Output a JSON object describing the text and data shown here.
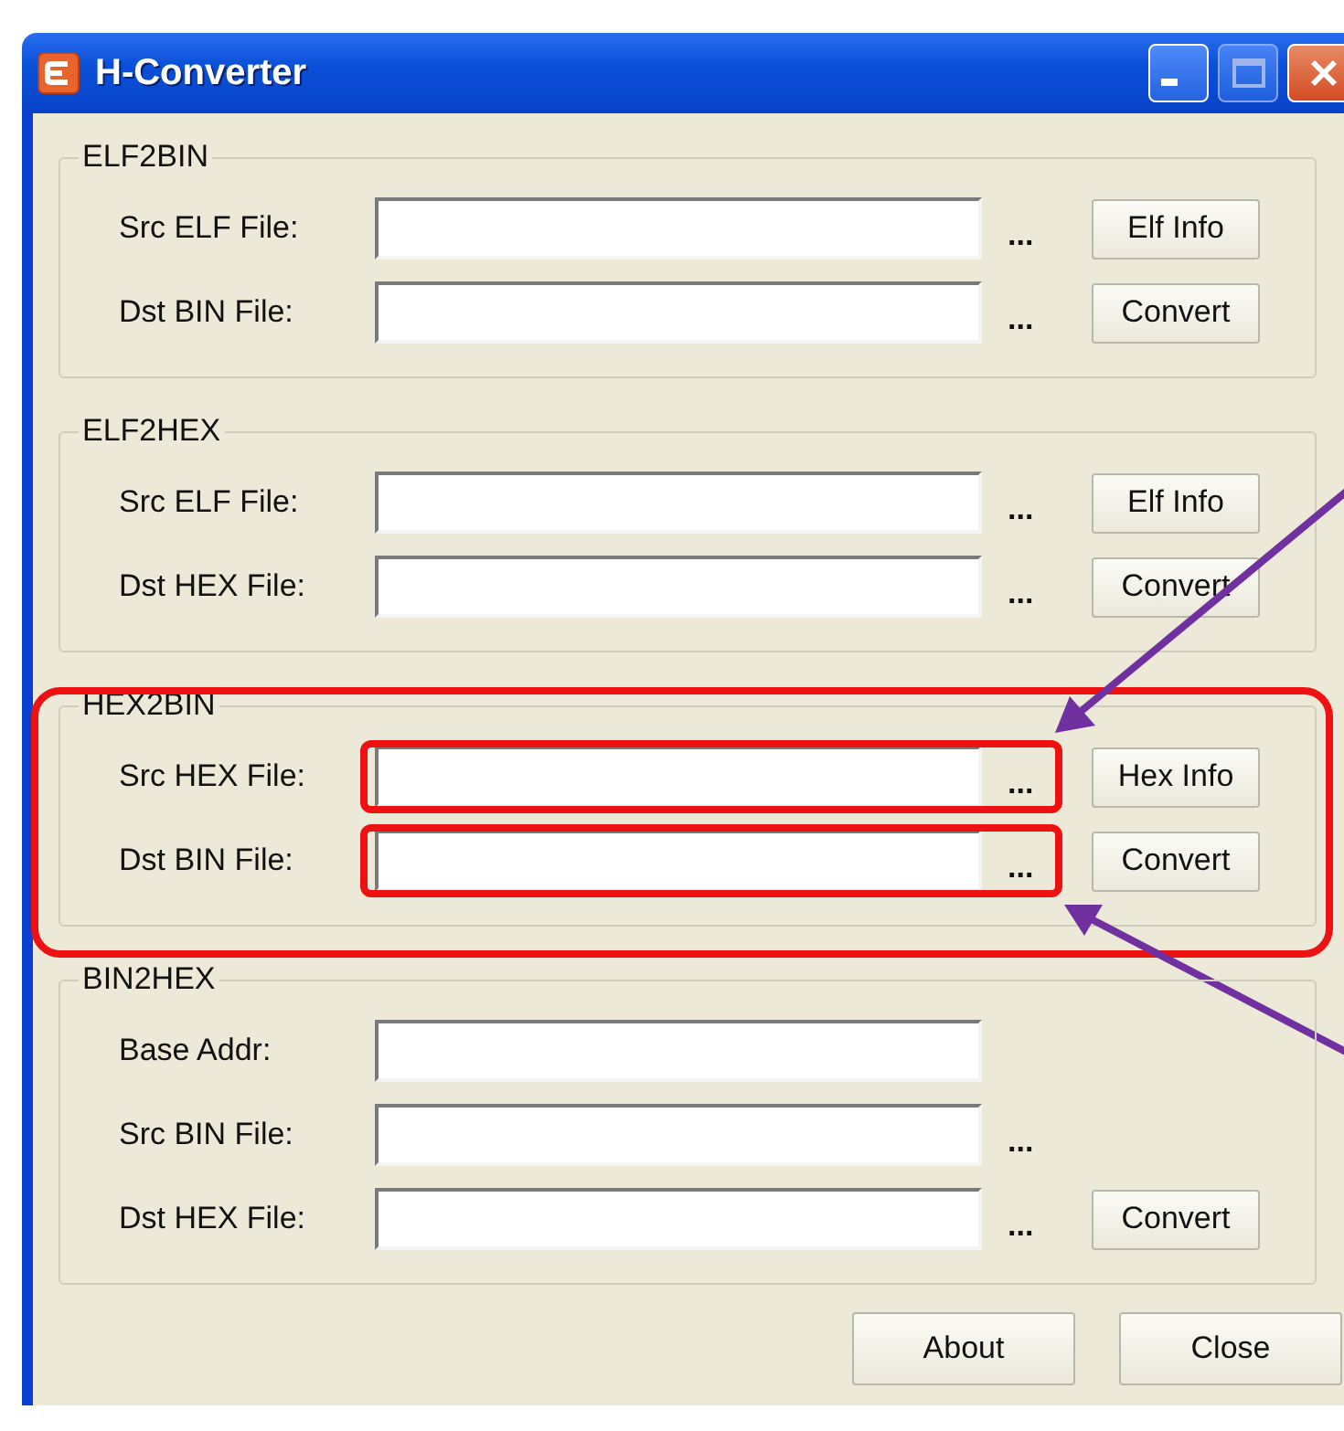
{
  "window": {
    "title": "H-Converter"
  },
  "groups": [
    {
      "title": "ELF2BIN",
      "highlighted": false,
      "rows": [
        {
          "label": "Src ELF File:",
          "browse": "...",
          "button": "Elf Info",
          "highlighted": false
        },
        {
          "label": "Dst BIN File:",
          "browse": "...",
          "button": "Convert",
          "highlighted": false
        }
      ]
    },
    {
      "title": "ELF2HEX",
      "highlighted": false,
      "rows": [
        {
          "label": "Src ELF File:",
          "browse": "...",
          "button": "Elf Info",
          "highlighted": false
        },
        {
          "label": "Dst HEX File:",
          "browse": "...",
          "button": "Convert",
          "highlighted": false
        }
      ]
    },
    {
      "title": "HEX2BIN",
      "highlighted": true,
      "rows": [
        {
          "label": "Src HEX File:",
          "browse": "...",
          "button": "Hex Info",
          "highlighted": true
        },
        {
          "label": "Dst BIN File:",
          "browse": "...",
          "button": "Convert",
          "highlighted": true
        }
      ]
    },
    {
      "title": "BIN2HEX",
      "highlighted": false,
      "rows": [
        {
          "label": "Base Addr:",
          "highlighted": false
        },
        {
          "label": "Src BIN File:",
          "browse": "...",
          "highlighted": false
        },
        {
          "label": "Dst HEX File:",
          "browse": "...",
          "button": "Convert",
          "highlighted": false
        }
      ]
    }
  ],
  "buttons": [
    "About",
    "Close"
  ]
}
